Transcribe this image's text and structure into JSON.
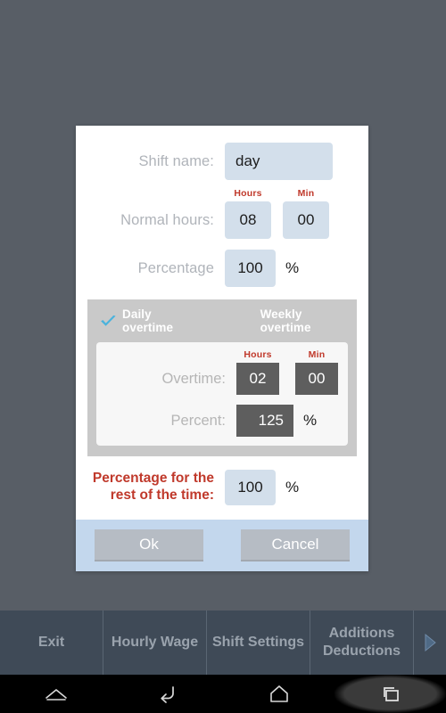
{
  "dialog": {
    "shift_name": {
      "label": "Shift name:",
      "value": "day"
    },
    "columns": {
      "hours": "Hours",
      "min": "Min"
    },
    "normal_hours": {
      "label": "Normal hours:",
      "hours": "08",
      "min": "00"
    },
    "percentage": {
      "label": "Percentage",
      "value": "100",
      "unit": "%"
    },
    "overtime_panel": {
      "tabs": [
        {
          "label": "Daily overtime",
          "selected": true,
          "icon": "check-icon"
        },
        {
          "label": "Weekly overtime",
          "selected": false
        }
      ],
      "columns": {
        "hours": "Hours",
        "min": "Min"
      },
      "overtime": {
        "label": "Overtime:",
        "hours": "02",
        "min": "00"
      },
      "percent": {
        "label": "Percent:",
        "value": "125",
        "unit": "%"
      }
    },
    "rest_of_time": {
      "label": "Percentage for the rest of the time:",
      "value": "100",
      "unit": "%"
    },
    "buttons": {
      "ok": "Ok",
      "cancel": "Cancel"
    }
  },
  "tabbar": {
    "items": [
      {
        "label": "Exit"
      },
      {
        "label": "Hourly Wage"
      },
      {
        "label": "Shift Settings"
      },
      {
        "label": "Additions Deductions"
      }
    ],
    "scroll_right_icon": "chevron-right-icon"
  },
  "navbar": {
    "buttons": [
      {
        "icon": "collapse-keyboard-icon"
      },
      {
        "icon": "back-icon"
      },
      {
        "icon": "home-icon"
      },
      {
        "icon": "recents-icon"
      }
    ]
  },
  "colors": {
    "scrim": "#585e66",
    "field_light": "#d3dfeb",
    "field_dark": "#5e5e5e",
    "accent_red": "#c0392b",
    "footer": "#c3d7ed",
    "panel_grey": "#c9c9c9",
    "check_blue": "#4ab3dd",
    "tabbar": "#3f4a57"
  }
}
